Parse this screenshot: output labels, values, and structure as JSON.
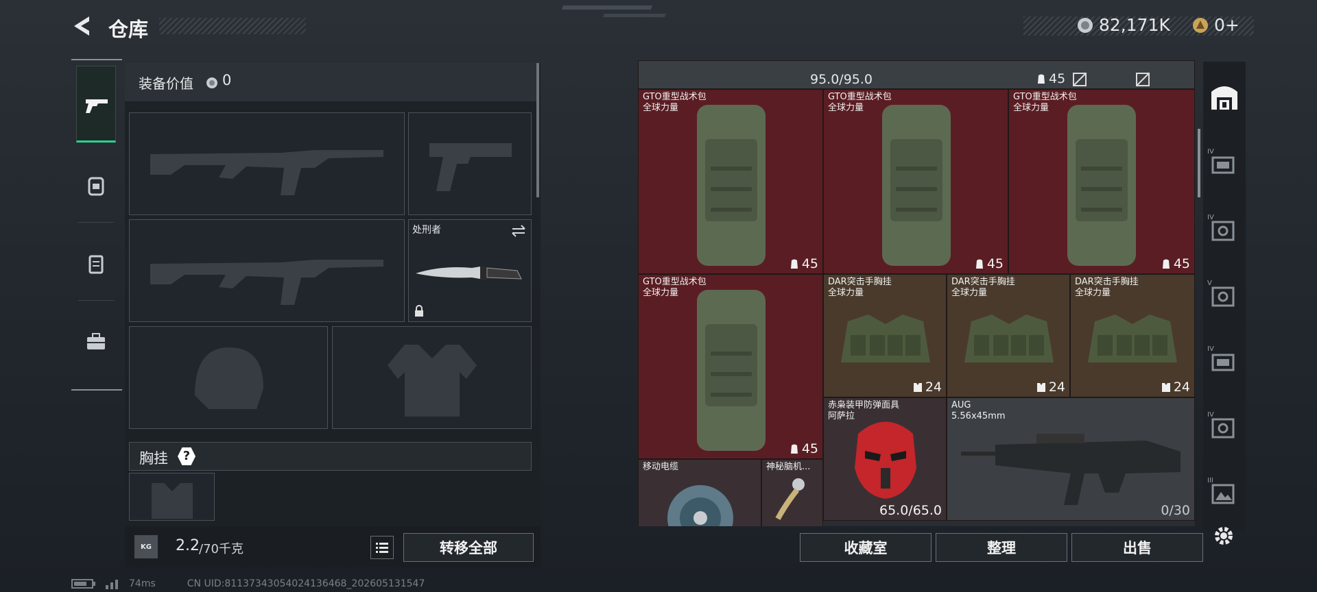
{
  "header": {
    "back_icon": "back-chevron-icon",
    "title": "仓库",
    "currency_value": "82,171K",
    "premium_value": "0+",
    "currency_icon": "silver-coin-icon",
    "premium_icon": "gold-coin-icon"
  },
  "left_panel": {
    "equip_value_label": "装备价值",
    "equip_value": "0",
    "knife_slot_label": "处刑者",
    "chest_rig_label": "胸挂",
    "chest_rig_help": "?",
    "weight_value": "2.2",
    "weight_limit": "/70千克",
    "weight_icon_text": "KG",
    "transfer_all_label": "转移全部"
  },
  "side_nav": [
    "pistol-icon",
    "backpack-icon",
    "container-icon",
    "briefcase-icon"
  ],
  "grid": {
    "top_row_value": "95.0/95.0",
    "top_row_badge": "45",
    "items": [
      {
        "name": "GTO重型战术包",
        "sub": "全球力量",
        "badge": "45"
      },
      {
        "name": "GTO重型战术包",
        "sub": "全球力量",
        "badge": "45"
      },
      {
        "name": "GTO重型战术包",
        "sub": "全球力量",
        "badge": "45"
      },
      {
        "name": "GTO重型战术包",
        "sub": "全球力量",
        "badge": "45"
      },
      {
        "name": "DAR突击手胸挂",
        "sub": "全球力量",
        "badge": "24"
      },
      {
        "name": "DAR突击手胸挂",
        "sub": "全球力量",
        "badge": "24"
      },
      {
        "name": "DAR突击手胸挂",
        "sub": "全球力量",
        "badge": "24"
      },
      {
        "name": "赤枭装甲防弹面具",
        "sub": "阿萨拉",
        "badge": "65.0/65.0"
      },
      {
        "name": "AUG",
        "sub": "5.56x45mm",
        "badge": "0/30"
      },
      {
        "name": "移动电缆",
        "sub": "",
        "badge": ""
      },
      {
        "name": "神秘脑机...",
        "sub": "",
        "badge": ""
      }
    ]
  },
  "bottom_buttons": {
    "collection": "收藏室",
    "sort": "整理",
    "sell": "出售"
  },
  "right_rail": {
    "tier_labels": [
      "IV",
      "IV",
      "V",
      "IV",
      "IV",
      "III"
    ]
  },
  "status_bar": {
    "ping": "74ms",
    "uid": "CN UID:81137343054024136468_202605131547"
  }
}
